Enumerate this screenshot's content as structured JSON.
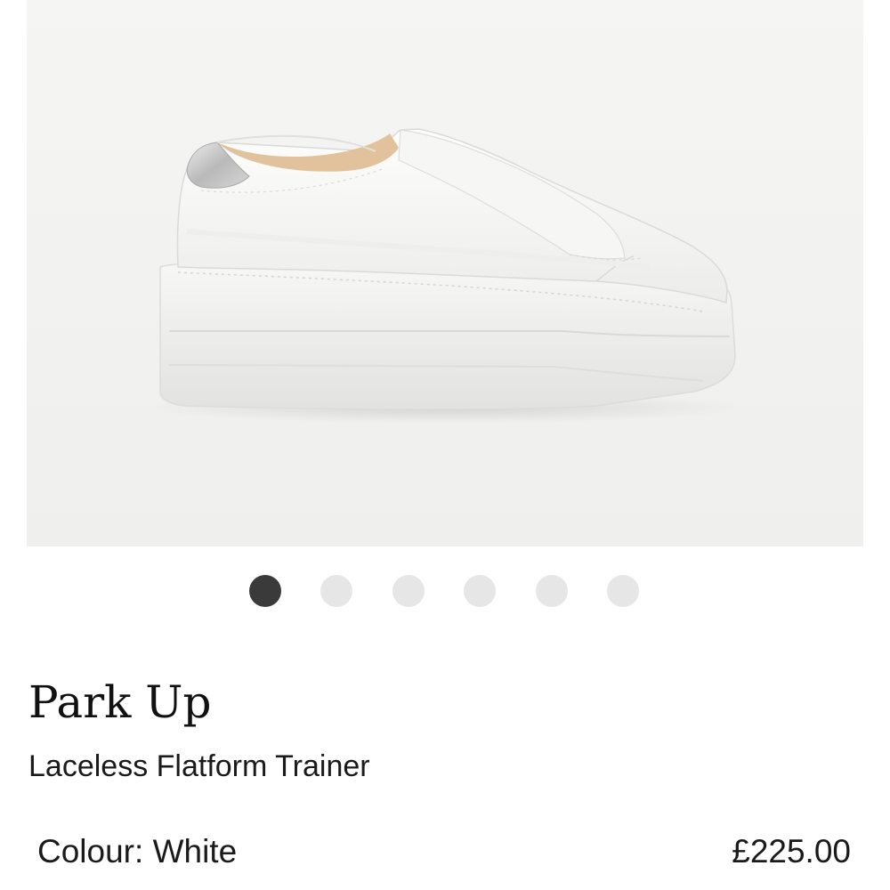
{
  "product": {
    "image_alt": "Park Up Laceless Flatform Trainer",
    "name": "Park Up",
    "subtitle": "Laceless Flatform Trainer",
    "colour_label": "Colour:",
    "colour_value": "White",
    "price": "£225.00"
  },
  "gallery": {
    "total_images": 6,
    "active_index": 0
  },
  "colors": {
    "background": "#ffffff",
    "image_backdrop": "#f4f4f2",
    "dot_active": "#3a3a3a",
    "dot_inactive": "#e6e6e6",
    "text": "#1a1a1a"
  }
}
